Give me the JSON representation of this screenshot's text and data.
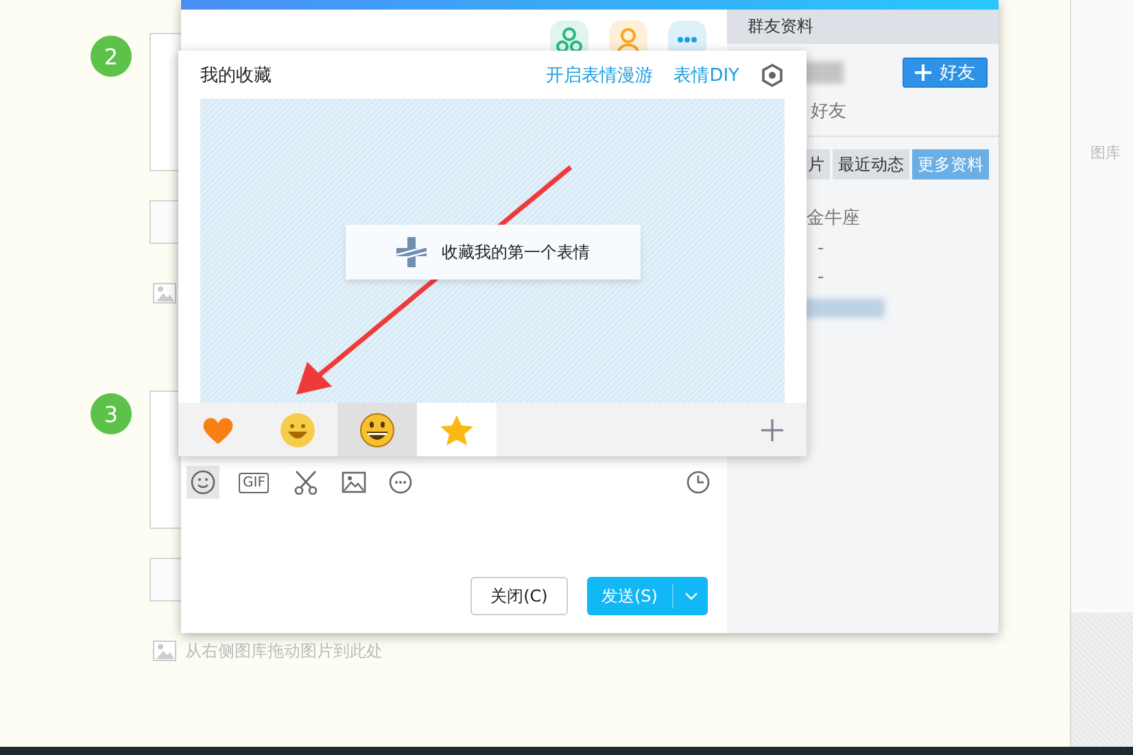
{
  "page": {
    "steps": [
      {
        "number": "2"
      },
      {
        "number": "3",
        "hint": "从右侧图库拖动图片到此处"
      }
    ],
    "gallery_label": "图库"
  },
  "profile": {
    "title": "群友资料",
    "add_button": "好友",
    "friend_label": "好友",
    "tabs": [
      {
        "label": "片",
        "selected": false
      },
      {
        "label": "最近动态",
        "selected": false
      },
      {
        "label": "更多资料",
        "selected": true
      }
    ],
    "fields": [
      "金牛座",
      "-",
      "-"
    ]
  },
  "emoji_panel": {
    "title": "我的收藏",
    "links": [
      "开启表情漫游",
      "表情DIY"
    ],
    "empty_prompt": "收藏我的第一个表情",
    "tabs": [
      {
        "kind": "heart",
        "selected": false
      },
      {
        "kind": "smiley",
        "selected": false
      },
      {
        "kind": "grin",
        "selected": false,
        "hovered": true
      },
      {
        "kind": "star",
        "selected": true
      }
    ]
  },
  "input_toolbar": {
    "tools": [
      {
        "kind": "emoji",
        "selected": true
      },
      {
        "kind": "gif",
        "label": "GIF",
        "selected": false
      },
      {
        "kind": "scissors",
        "selected": false
      },
      {
        "kind": "image",
        "selected": false
      },
      {
        "kind": "more",
        "selected": false
      }
    ]
  },
  "buttons": {
    "close": "关闭(C)",
    "send": "发送(S)"
  }
}
